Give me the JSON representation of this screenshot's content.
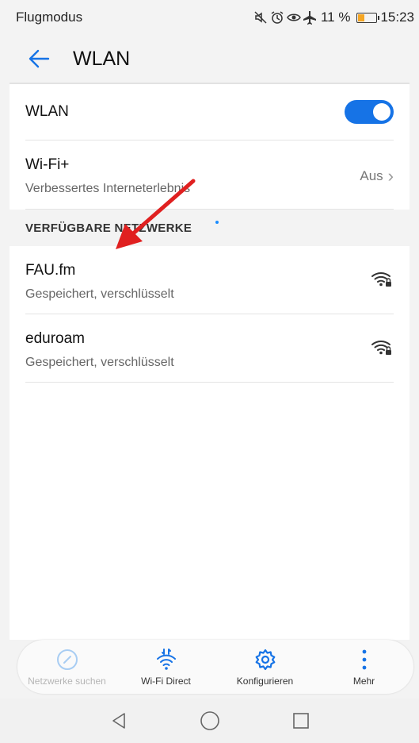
{
  "status_bar": {
    "mode_label": "Flugmodus",
    "icons": [
      "mute-icon",
      "alarm-icon",
      "eye-comfort-icon",
      "airplane-icon"
    ],
    "battery_percent": "11 %",
    "time": "15:23"
  },
  "app_bar": {
    "title": "WLAN"
  },
  "wlan_toggle": {
    "label": "WLAN",
    "enabled": true,
    "accent_color": "#1673e6"
  },
  "wifi_plus": {
    "label": "Wi-Fi+",
    "subtitle": "Verbessertes Interneterlebnis",
    "value": "Aus"
  },
  "networks_section": {
    "header": "VERFÜGBARE NETZWERKE",
    "networks": [
      {
        "name": "FAU.fm",
        "status": "Gespeichert, verschlüsselt",
        "icon": "wifi-lock-icon"
      },
      {
        "name": "eduroam",
        "status": "Gespeichert, verschlüsselt",
        "icon": "wifi-lock-icon"
      }
    ]
  },
  "toolbar": {
    "items": [
      {
        "label": "Netzwerke suchen",
        "icon": "scan-icon",
        "enabled": false
      },
      {
        "label": "Wi-Fi Direct",
        "icon": "wifi-direct-icon",
        "enabled": true
      },
      {
        "label": "Konfigurieren",
        "icon": "gear-icon",
        "enabled": true
      },
      {
        "label": "Mehr",
        "icon": "more-icon",
        "enabled": true
      }
    ]
  },
  "annotation": {
    "color": "#e02020"
  }
}
